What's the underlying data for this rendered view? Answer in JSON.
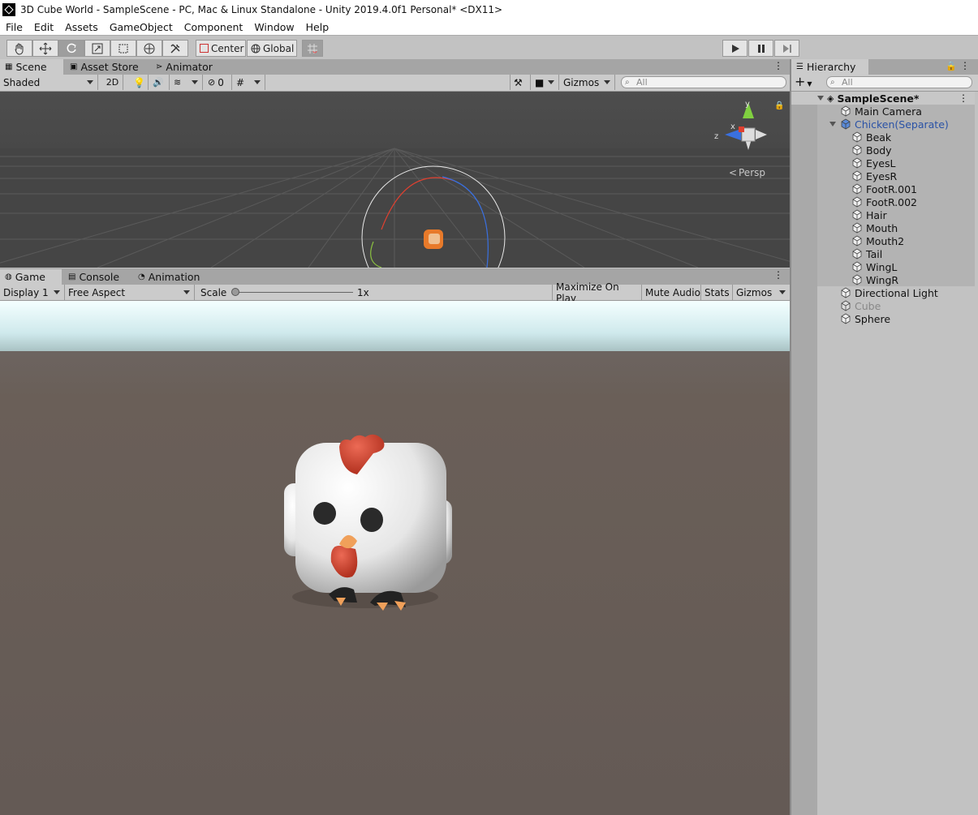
{
  "title": "3D Cube World - SampleScene - PC, Mac & Linux Standalone - Unity 2019.4.0f1 Personal* <DX11>",
  "menu": [
    "File",
    "Edit",
    "Assets",
    "GameObject",
    "Component",
    "Window",
    "Help"
  ],
  "toolbar": {
    "tools": [
      "hand-tool",
      "move-tool",
      "rotate-tool",
      "scale-tool",
      "rect-tool",
      "transform-tool",
      "custom-tool"
    ],
    "center_label": "Center",
    "global_label": "Global"
  },
  "scene_panel": {
    "tabs": [
      "Scene",
      "Asset Store",
      "Animator"
    ],
    "shading": "Shaded",
    "mode_2d": "2D",
    "hidden_count": "0",
    "gizmos_label": "Gizmos",
    "search_placeholder": "All",
    "persp_label": "Persp",
    "axis_x": "x",
    "axis_y": "y",
    "axis_z": "z"
  },
  "game_panel": {
    "tabs": [
      "Game",
      "Console",
      "Animation"
    ],
    "display": "Display 1",
    "aspect": "Free Aspect",
    "scale_label": "Scale",
    "scale_value": "1x",
    "maximize": "Maximize On Play",
    "mute": "Mute Audio",
    "stats": "Stats",
    "gizmos": "Gizmos"
  },
  "hierarchy": {
    "tab": "Hierarchy",
    "search_placeholder": "All",
    "scene_name": "SampleScene*",
    "items": [
      {
        "label": "Main Camera",
        "depth": 1
      },
      {
        "label": "Chicken(Separate)",
        "depth": 1,
        "expanded": true,
        "prefab": true
      },
      {
        "label": "Beak",
        "depth": 2
      },
      {
        "label": "Body",
        "depth": 2
      },
      {
        "label": "EyesL",
        "depth": 2
      },
      {
        "label": "EyesR",
        "depth": 2
      },
      {
        "label": "FootR.001",
        "depth": 2
      },
      {
        "label": "FootR.002",
        "depth": 2
      },
      {
        "label": "Hair",
        "depth": 2
      },
      {
        "label": "Mouth",
        "depth": 2
      },
      {
        "label": "Mouth2",
        "depth": 2
      },
      {
        "label": "Tail",
        "depth": 2
      },
      {
        "label": "WingL",
        "depth": 2
      },
      {
        "label": "WingR",
        "depth": 2
      },
      {
        "label": "Directional Light",
        "depth": 1
      },
      {
        "label": "Cube",
        "depth": 1,
        "disabled": true
      },
      {
        "label": "Sphere",
        "depth": 1
      }
    ]
  }
}
